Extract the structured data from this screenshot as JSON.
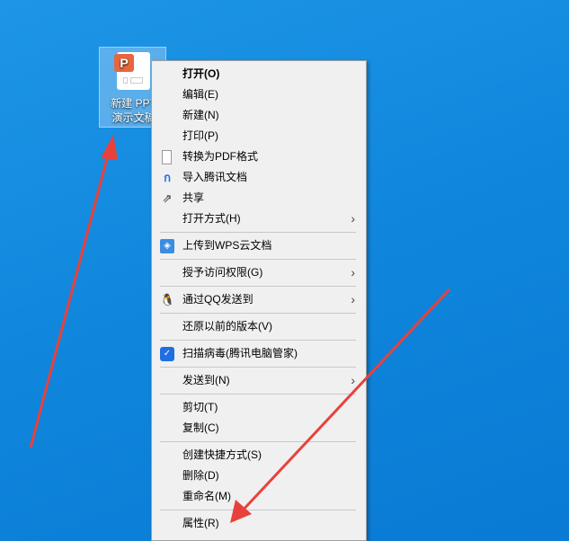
{
  "desktop_icon": {
    "line1": "新建 PPT",
    "line2": "演示文稿",
    "badge": "P"
  },
  "menu": {
    "open": "打开(O)",
    "edit": "编辑(E)",
    "new": "新建(N)",
    "print": "打印(P)",
    "to_pdf": "转换为PDF格式",
    "import_tencent": "导入腾讯文档",
    "share": "共享",
    "open_with": "打开方式(H)",
    "upload_wps": "上传到WPS云文档",
    "grant_access": "授予访问权限(G)",
    "send_qq": "通过QQ发送到",
    "restore": "还原以前的版本(V)",
    "scan": "扫描病毒(腾讯电脑管家)",
    "send_to": "发送到(N)",
    "cut": "剪切(T)",
    "copy": "复制(C)",
    "shortcut": "创建快捷方式(S)",
    "delete": "删除(D)",
    "rename": "重命名(M)",
    "properties": "属性(R)"
  },
  "colors": {
    "annotation": "#e8413c",
    "desktop": "#0f86dc"
  }
}
